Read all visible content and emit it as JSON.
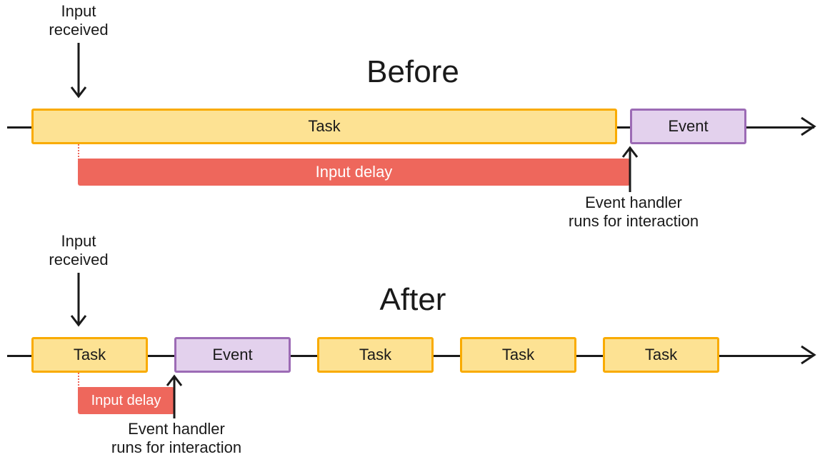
{
  "titles": {
    "before": "Before",
    "after": "After"
  },
  "labels": {
    "input_received": "Input\nreceived",
    "task": "Task",
    "event": "Event",
    "input_delay": "Input delay",
    "event_handler": "Event handler\nruns for interaction"
  }
}
